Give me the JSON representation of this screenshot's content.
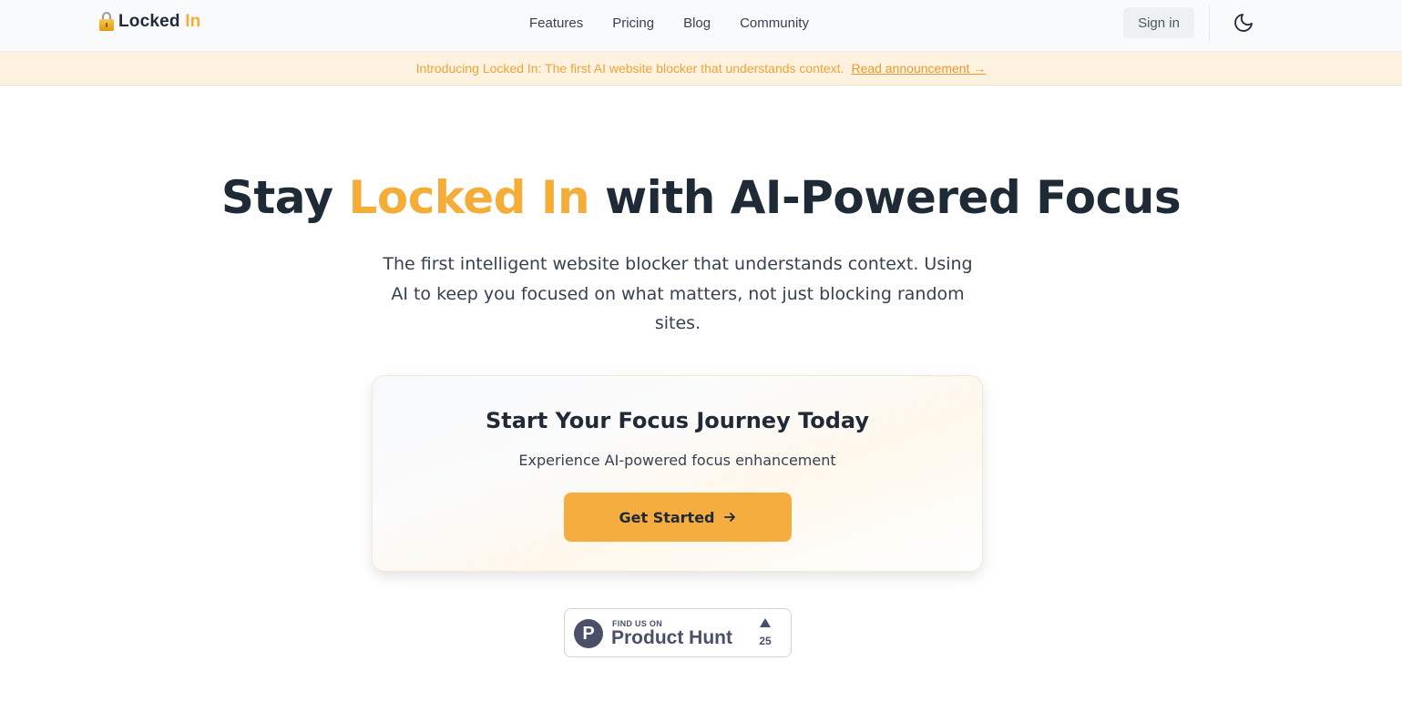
{
  "header": {
    "brand": "Locked ",
    "brand_accent": "In",
    "nav": [
      "Features",
      "Pricing",
      "Blog",
      "Community"
    ],
    "signin_label": "Sign in"
  },
  "announcement": {
    "text": "Introducing Locked In: The first AI website blocker that understands context.",
    "link": "Read announcement →"
  },
  "hero": {
    "title_start": "Stay ",
    "title_accent": "Locked In",
    "title_end": " with AI-Powered Focus",
    "subtitle": "The first intelligent website blocker that understands context. Using AI to keep you focused on what matters, not just blocking random sites."
  },
  "cta_card": {
    "title": "Start Your Focus Journey Today",
    "subtitle": "Experience AI-powered focus enhancement",
    "button": "Get Started"
  },
  "product_hunt": {
    "logo_letter": "P",
    "find_text": "FIND US ON",
    "name": "Product Hunt",
    "upvotes": "25"
  },
  "colors": {
    "accent": "#f5ad3a",
    "text_dark": "#1f2937",
    "announce_bg": "#fdf2e0",
    "button_bg": "#f5ad3f"
  },
  "icons": {
    "logo": "lock-icon",
    "theme_toggle": "moon-icon",
    "cta": "arrow-right-icon",
    "product_hunt": "upvote-triangle-icon"
  }
}
